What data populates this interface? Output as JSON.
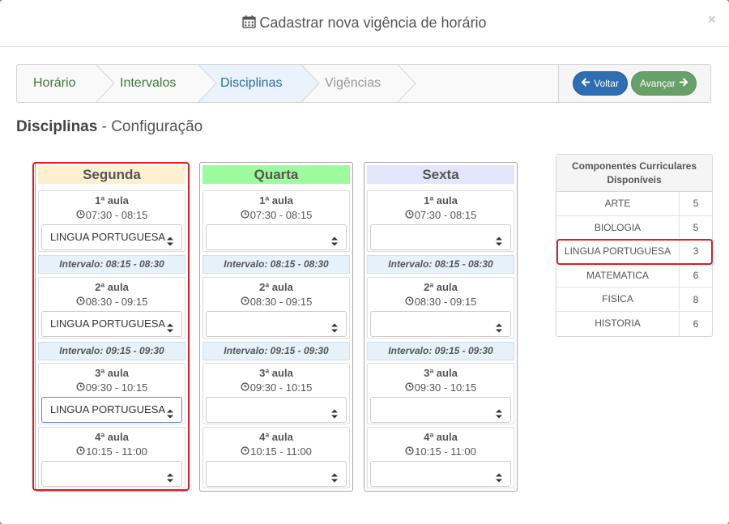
{
  "modal": {
    "title": "Cadastrar nova vigência de horário",
    "close": "×"
  },
  "wizard": {
    "steps": [
      {
        "label": "Horário",
        "state": "done",
        "color": "#3c7a3c"
      },
      {
        "label": "Intervalos",
        "state": "done",
        "color": "#3c7a3c"
      },
      {
        "label": "Disciplinas",
        "state": "active",
        "color": "#2c6aa6"
      },
      {
        "label": "Vigências",
        "state": "todo",
        "color": "#999999"
      }
    ],
    "back_label": "Voltar",
    "next_label": "Avançar"
  },
  "section": {
    "bold": "Disciplinas",
    "rest": " - Configuração"
  },
  "days": [
    {
      "name": "Segunda",
      "header_color": "#fdf0d0",
      "aulas": [
        {
          "title": "1ª aula",
          "time": "07:30 - 08:15",
          "selected": "LINGUA PORTUGUESA"
        },
        {
          "title": "2ª aula",
          "time": "08:30 - 09:15",
          "selected": "LINGUA PORTUGUESA"
        },
        {
          "title": "3ª aula",
          "time": "09:30 - 10:15",
          "selected": "LINGUA PORTUGUESA"
        },
        {
          "title": "4ª aula",
          "time": "10:15 - 11:00",
          "selected": ""
        }
      ],
      "intervalos": [
        "Intervalo: 08:15 - 08:30",
        "Intervalo: 09:15 - 09:30"
      ]
    },
    {
      "name": "Quarta",
      "header_color": "#9cfb9c",
      "aulas": [
        {
          "title": "1ª aula",
          "time": "07:30 - 08:15",
          "selected": ""
        },
        {
          "title": "2ª aula",
          "time": "08:30 - 09:15",
          "selected": ""
        },
        {
          "title": "3ª aula",
          "time": "09:30 - 10:15",
          "selected": ""
        },
        {
          "title": "4ª aula",
          "time": "10:15 - 11:00",
          "selected": ""
        }
      ],
      "intervalos": [
        "Intervalo: 08:15 - 08:30",
        "Intervalo: 09:15 - 09:30"
      ]
    },
    {
      "name": "Sexta",
      "header_color": "#e4e4fa",
      "aulas": [
        {
          "title": "1ª aula",
          "time": "07:30 - 08:15",
          "selected": ""
        },
        {
          "title": "2ª aula",
          "time": "08:30 - 09:15",
          "selected": ""
        },
        {
          "title": "3ª aula",
          "time": "09:30 - 10:15",
          "selected": ""
        },
        {
          "title": "4ª aula",
          "time": "10:15 - 11:00",
          "selected": ""
        }
      ],
      "intervalos": [
        "Intervalo: 08:15 - 08:30",
        "Intervalo: 09:15 - 09:30"
      ]
    }
  ],
  "componentes": {
    "title_line1": "Componentes Curriculares",
    "title_line2": "Disponíveis",
    "rows": [
      {
        "name": "ARTE",
        "count": "5"
      },
      {
        "name": "BIOLOGIA",
        "count": "5"
      },
      {
        "name": "LINGUA PORTUGUESA",
        "count": "3"
      },
      {
        "name": "MATEMATICA",
        "count": "6"
      },
      {
        "name": "FISICA",
        "count": "8"
      },
      {
        "name": "HISTORIA",
        "count": "6"
      }
    ]
  },
  "icons": {
    "title": "calendar-icon",
    "time": "clock-icon",
    "select": "sort-caret-icon",
    "back": "arrow-left-icon",
    "next": "arrow-right-icon"
  },
  "highlight_color": "#e01b24"
}
